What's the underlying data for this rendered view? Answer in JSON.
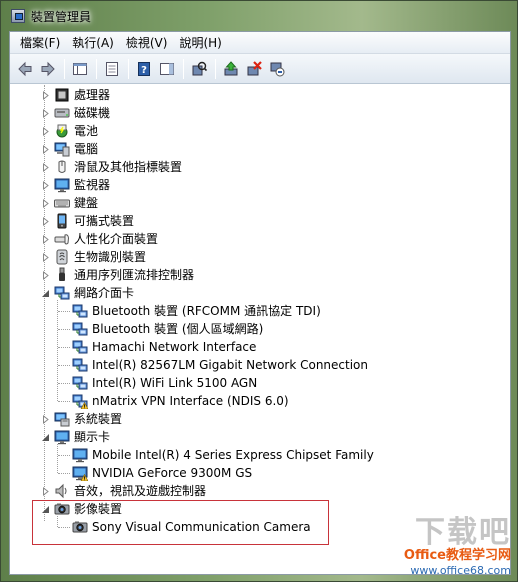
{
  "window": {
    "title": "裝置管理員"
  },
  "menu": [
    "檔案(F)",
    "執行(A)",
    "檢視(V)",
    "說明(H)"
  ],
  "toolbar": [
    {
      "icon": "back-arrow-icon"
    },
    {
      "icon": "forward-arrow-icon"
    },
    {
      "sep": true
    },
    {
      "icon": "console-tree-icon"
    },
    {
      "sep": true
    },
    {
      "icon": "properties-icon"
    },
    {
      "sep": true
    },
    {
      "icon": "help-icon"
    },
    {
      "icon": "action-pane-icon"
    },
    {
      "sep": true
    },
    {
      "icon": "scan-hardware-icon"
    },
    {
      "sep": true
    },
    {
      "icon": "update-driver-icon"
    },
    {
      "icon": "uninstall-icon"
    },
    {
      "icon": "disable-device-icon"
    }
  ],
  "tree": {
    "categories": [
      {
        "label": "處理器",
        "icon": "processor-icon",
        "expanded": false
      },
      {
        "label": "磁碟機",
        "icon": "disk-drive-icon",
        "expanded": false
      },
      {
        "label": "電池",
        "icon": "battery-icon",
        "expanded": false
      },
      {
        "label": "電腦",
        "icon": "computer-icon",
        "expanded": false
      },
      {
        "label": "滑鼠及其他指標裝置",
        "icon": "mouse-icon",
        "expanded": false
      },
      {
        "label": "監視器",
        "icon": "monitor-icon",
        "expanded": false
      },
      {
        "label": "鍵盤",
        "icon": "keyboard-icon",
        "expanded": false
      },
      {
        "label": "可攜式裝置",
        "icon": "portable-device-icon",
        "expanded": false
      },
      {
        "label": "人性化介面裝置",
        "icon": "hid-icon",
        "expanded": false
      },
      {
        "label": "生物識別裝置",
        "icon": "biometric-icon",
        "expanded": false
      },
      {
        "label": "通用序列匯流排控制器",
        "icon": "usb-icon",
        "expanded": false
      },
      {
        "label": "網路介面卡",
        "icon": "network-adapter-icon",
        "expanded": true,
        "children": [
          {
            "label": "Bluetooth 裝置 (RFCOMM 通訊協定 TDI)",
            "icon": "network-adapter-icon"
          },
          {
            "label": "Bluetooth 裝置 (個人區域網路)",
            "icon": "network-adapter-icon"
          },
          {
            "label": "Hamachi Network Interface",
            "icon": "network-adapter-icon"
          },
          {
            "label": "Intel(R) 82567LM Gigabit Network Connection",
            "icon": "network-adapter-icon"
          },
          {
            "label": "Intel(R) WiFi Link 5100 AGN",
            "icon": "network-adapter-icon"
          },
          {
            "label": "nMatrix VPN Interface (NDIS 6.0)",
            "icon": "network-adapter-warning-icon"
          }
        ]
      },
      {
        "label": "系統裝置",
        "icon": "system-device-icon",
        "expanded": false
      },
      {
        "label": "顯示卡",
        "icon": "display-adapter-icon",
        "expanded": true,
        "children": [
          {
            "label": "Mobile Intel(R) 4 Series Express Chipset Family",
            "icon": "display-adapter-icon"
          },
          {
            "label": "NVIDIA GeForce 9300M GS",
            "icon": "display-adapter-warning-icon"
          }
        ]
      },
      {
        "label": "音效，視訊及遊戲控制器",
        "icon": "sound-icon",
        "expanded": false
      },
      {
        "label": "影像裝置",
        "icon": "imaging-device-icon",
        "expanded": true,
        "children": [
          {
            "label": "Sony Visual Communication Camera",
            "icon": "camera-icon"
          }
        ]
      }
    ]
  },
  "watermark": {
    "big": "下载吧",
    "brand": "Office教程学习网",
    "url": "www.office68.com"
  }
}
